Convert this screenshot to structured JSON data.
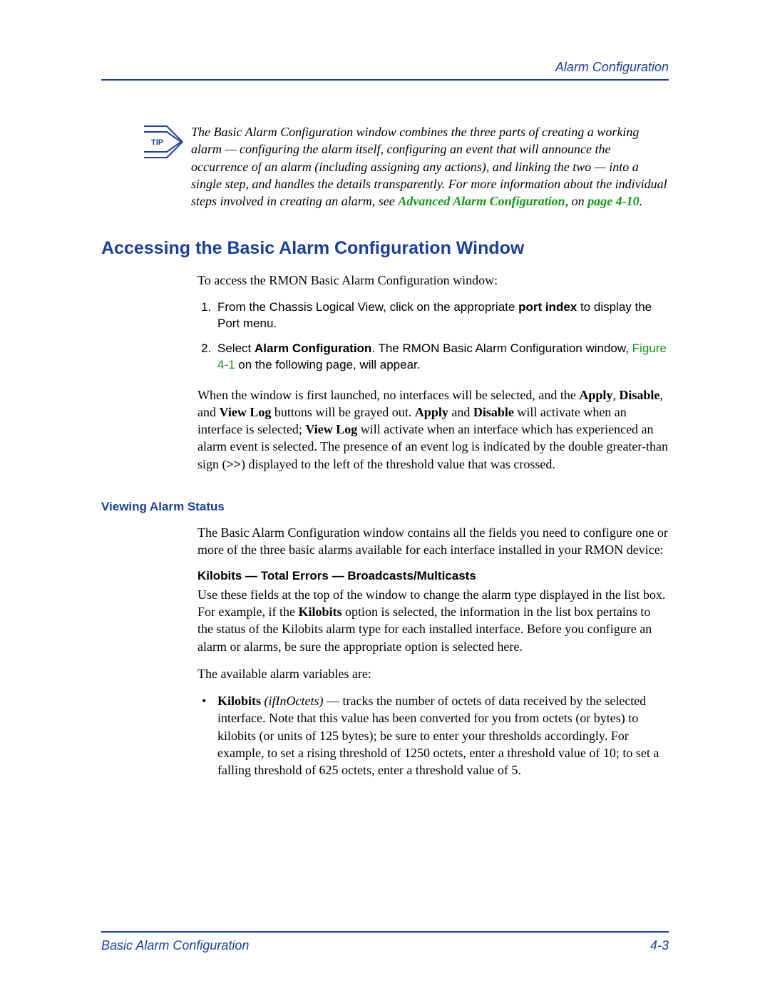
{
  "header": {
    "right": "Alarm Configuration"
  },
  "tip": {
    "label": "TIP",
    "text_before_xref": "The Basic Alarm Configuration window combines the three parts of creating a working alarm — configuring the alarm itself, configuring an event that will announce the occurrence of an alarm (including assigning any actions), and linking the two — into a single step, and handles the details transparently. For more information about the individual steps involved in creating an alarm, see ",
    "xref": "Advanced Alarm Configuration",
    "text_mid": ", on ",
    "page_ref": "page 4-10",
    "text_after": "."
  },
  "section_heading": "Accessing the Basic Alarm Configuration Window",
  "intro": "To access the RMON Basic Alarm Configuration window:",
  "steps": {
    "s1_a": "From the Chassis Logical View, click on the appropriate ",
    "s1_bold": "port index",
    "s1_b": " to display the Port menu.",
    "s2_a": "Select ",
    "s2_bold": "Alarm Configuration",
    "s2_b": ". The RMON Basic Alarm Configuration window, ",
    "s2_fig": "Figure 4-1",
    "s2_c": " on the following page, will appear."
  },
  "paragraph_after_steps": {
    "a": "When the window is first launched, no interfaces will be selected, and the ",
    "b1": "Apply",
    "c": ", ",
    "b2": "Disable",
    "d": ", and ",
    "b3": "View Log",
    "e": " buttons will be grayed out. ",
    "b4": "Apply",
    "f": " and ",
    "b5": "Disable",
    "g": " will activate when an interface is selected; ",
    "b6": "View Log",
    "h": " will activate when an interface which has experienced an alarm event is selected. The presence of an event log is indicated by the double greater-than sign (",
    "b7": ">>",
    "i": ") displayed to the left of the threshold value that was crossed."
  },
  "subhead": "Viewing Alarm Status",
  "viewing_intro": "The Basic Alarm Configuration window contains all the fields you need to configure one or more of the three basic alarms available for each interface installed in your RMON device:",
  "inline_head": "Kilobits — Total Errors — Broadcasts/Multicasts",
  "inline_para_a": "Use these fields at the top of the window to change the alarm type displayed in the list box. For example, if the ",
  "inline_para_b": "Kilobits",
  "inline_para_c": " option is selected, the information in the list box pertains to the status of the Kilobits alarm type for each installed interface. Before you configure an alarm or alarms, be sure the appropriate option is selected here.",
  "avail_intro": "The available alarm variables are:",
  "bullet": {
    "b1": "Kilobits",
    "i1": " (ifInOctets)",
    "rest": " — tracks the number of octets of data received by the selected interface. Note that this value has been converted for you from octets (or bytes) to kilobits (or units of 125 bytes); be sure to enter your thresholds accordingly. For example, to set a rising threshold of 1250 octets, enter a threshold value of 10; to set a falling threshold of 625 octets, enter a threshold value of 5."
  },
  "footer": {
    "left": "Basic Alarm Configuration",
    "right": "4-3"
  }
}
